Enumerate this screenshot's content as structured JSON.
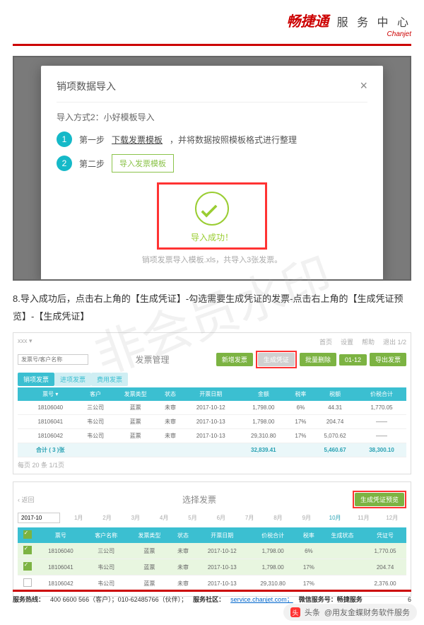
{
  "header": {
    "brand_cn": "畅捷通",
    "brand_en": "Chanjet",
    "title": "服 务 中 心"
  },
  "modal": {
    "title": "销项数据导入",
    "method_title": "导入方式2：小好模板导入",
    "step1_label": "第一步",
    "step1_link": "下载发票模板",
    "step1_tail": "，并将数据按照模板格式进行整理",
    "step2_label": "第二步",
    "step2_btn": "导入发票模板",
    "success": "导入成功！",
    "sub_note": "销项发票导入模板.xls，共导入3张发票。"
  },
  "body_text": "8.导入成功后，点击右上角的【生成凭证】-勾选需要生成凭证的发票-点击右上角的【生成凭证预览】-【生成凭证】",
  "watermark": "非会员水印",
  "panel2": {
    "breadcrumb": "xxx ▾",
    "top_right": [
      "首页",
      "设置",
      "帮助",
      "退出 1/2"
    ],
    "title": "发票管理",
    "actions": [
      "新增发票",
      "生成凭证",
      "批量删除",
      "01-12",
      "导出发票"
    ],
    "tabs": [
      "销项发票",
      "进项发票",
      "费用发票"
    ],
    "search_placeholder": "发票号/客户名称",
    "columns": [
      "",
      "票号 ▾",
      "客户",
      "发票类型",
      "状态",
      "开票日期",
      "金额",
      "税率",
      "税额",
      "价税合计"
    ],
    "rows": [
      [
        "",
        "18106040",
        "三公司",
        "蓝票",
        "未审",
        "2017-10-12",
        "1,798.00",
        "6%",
        "44.31",
        "1,770.05"
      ],
      [
        "",
        "18106041",
        "韦公司",
        "蓝票",
        "未审",
        "2017-10-13",
        "1,798.00",
        "17%",
        "204.74",
        "——"
      ],
      [
        "",
        "18106042",
        "韦公司",
        "蓝票",
        "未审",
        "2017-10-13",
        "29,310.80",
        "17%",
        "5,070.62",
        "——"
      ]
    ],
    "total_row": [
      "",
      "合计 ( 3 )张",
      "",
      "",
      "",
      "",
      "32,839.41",
      "",
      "5,460.67",
      "38,300.10"
    ],
    "pager": "每页 20 条  1/1页"
  },
  "panel3": {
    "title": "选择发票",
    "generate_btn": "生成凭证预览",
    "period_input": "2017-10",
    "months": [
      "1月",
      "2月",
      "3月",
      "4月",
      "5月",
      "6月",
      "7月",
      "8月",
      "9月",
      "10月",
      "11月",
      "12月"
    ],
    "active_month_index": 9,
    "columns": [
      "",
      "票号",
      "客户名称",
      "发票类型",
      "状态",
      "开票日期",
      "价税合计",
      "税率",
      "生成状态",
      "凭证号"
    ],
    "rows": [
      {
        "checked": true,
        "cells": [
          "18106040",
          "三公司",
          "蓝票",
          "未审",
          "2017-10-12",
          "1,798.00",
          "6%",
          "",
          "1,770.05"
        ]
      },
      {
        "checked": true,
        "cells": [
          "18106041",
          "韦公司",
          "蓝票",
          "未审",
          "2017-10-13",
          "1,798.00",
          "17%",
          "",
          "204.74"
        ]
      },
      {
        "checked": false,
        "cells": [
          "18106042",
          "韦公司",
          "蓝票",
          "未审",
          "2017-10-13",
          "29,310.80",
          "17%",
          "",
          "2,376.00"
        ]
      }
    ]
  },
  "footer": {
    "hotline_label": "服务热线：",
    "hotline": "400 6600 566（客户）；010-62485766（伙伴）；",
    "community_label": "服务社区：",
    "community_url": "service.chanjet.com；",
    "wechat_label": "微信服务号：畅捷服务",
    "page_no": "6"
  },
  "toutiao": {
    "label": "头条",
    "author": "@用友金蝶财务软件服务"
  }
}
